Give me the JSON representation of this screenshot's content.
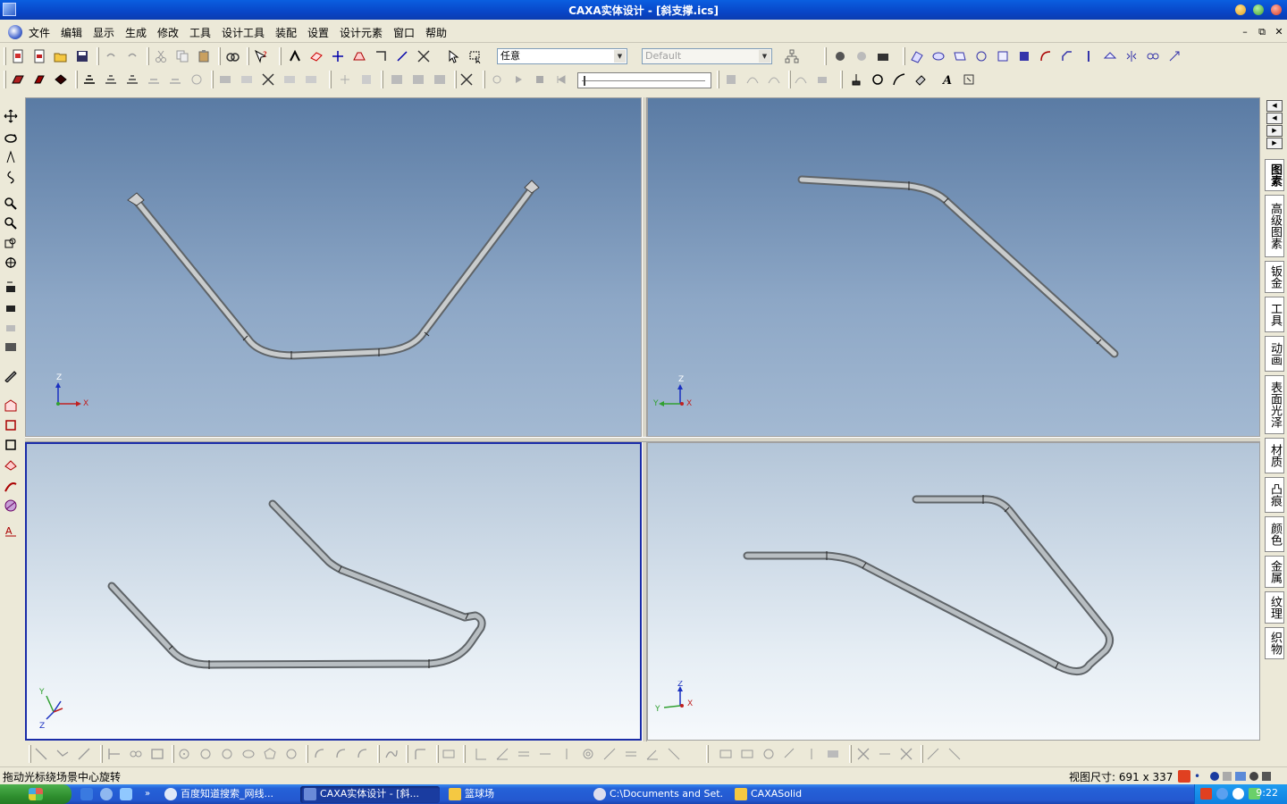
{
  "window": {
    "title": "CAXA实体设计 - [斜支撑.ics]"
  },
  "menu": {
    "items": [
      "文件",
      "编辑",
      "显示",
      "生成",
      "修改",
      "工具",
      "设计工具",
      "装配",
      "设置",
      "设计元素",
      "窗口",
      "帮助"
    ]
  },
  "toolbar": {
    "filter_select": {
      "value": "任意"
    },
    "style_select": {
      "value": "Default"
    }
  },
  "right_panel": {
    "tabs": [
      "图素",
      "高级图素",
      "钣金",
      "工具",
      "动画",
      "表面光泽",
      "材质",
      "凸痕",
      "颜色",
      "金属",
      "纹理",
      "织物"
    ],
    "active_tab": "图素"
  },
  "viewports": {
    "front": {
      "axes": [
        "Z",
        "X"
      ]
    },
    "side": {
      "axes": [
        "Z",
        "Y",
        "X"
      ]
    },
    "iso": {
      "axes": [
        "Y",
        "Z"
      ]
    },
    "top_iso": {
      "axes": [
        "Z",
        "Y",
        "X"
      ]
    }
  },
  "status": {
    "message": "拖动光标绕场景中心旋转",
    "view_size": "视图尺寸: 691 x 337"
  },
  "taskbar": {
    "tasks": [
      {
        "label": "百度知道搜索_网线..."
      },
      {
        "label": "CAXA实体设计 - [斜..."
      },
      {
        "label": "篮球场"
      },
      {
        "label": "C:\\Documents and Set..."
      },
      {
        "label": "CAXASolid"
      }
    ],
    "clock": "9:22"
  },
  "colors": {
    "title_blue": "#0a5fe0",
    "viewport_top": "#5a7ba4",
    "active_border": "#1a2ca8"
  }
}
